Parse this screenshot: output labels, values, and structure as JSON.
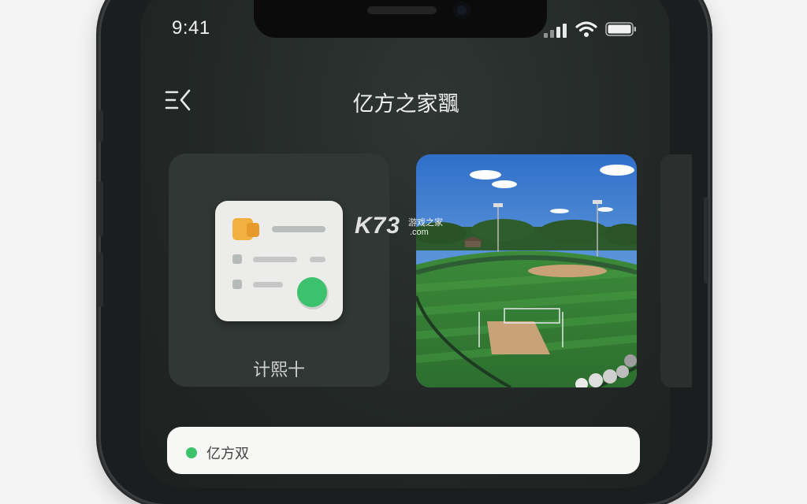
{
  "status_bar": {
    "time": "9:41",
    "icons": [
      "signal-icon",
      "wifi-icon",
      "battery-icon"
    ]
  },
  "header": {
    "menu_icon": "menu-collapse-icon",
    "title": "亿方之家飁"
  },
  "cards": [
    {
      "label": "计熙十",
      "icon": "checklist-widget-icon"
    },
    {
      "image": "baseball-field-photo"
    }
  ],
  "watermark": {
    "logo": "K73",
    "sub": "游戏之家",
    "domain": ".com"
  },
  "bottom_card": {
    "text": "亿方双"
  },
  "colors": {
    "background": "#232826",
    "card": "#313734",
    "accent_green": "#3cc26c",
    "widget_orange": "#f2b040"
  }
}
